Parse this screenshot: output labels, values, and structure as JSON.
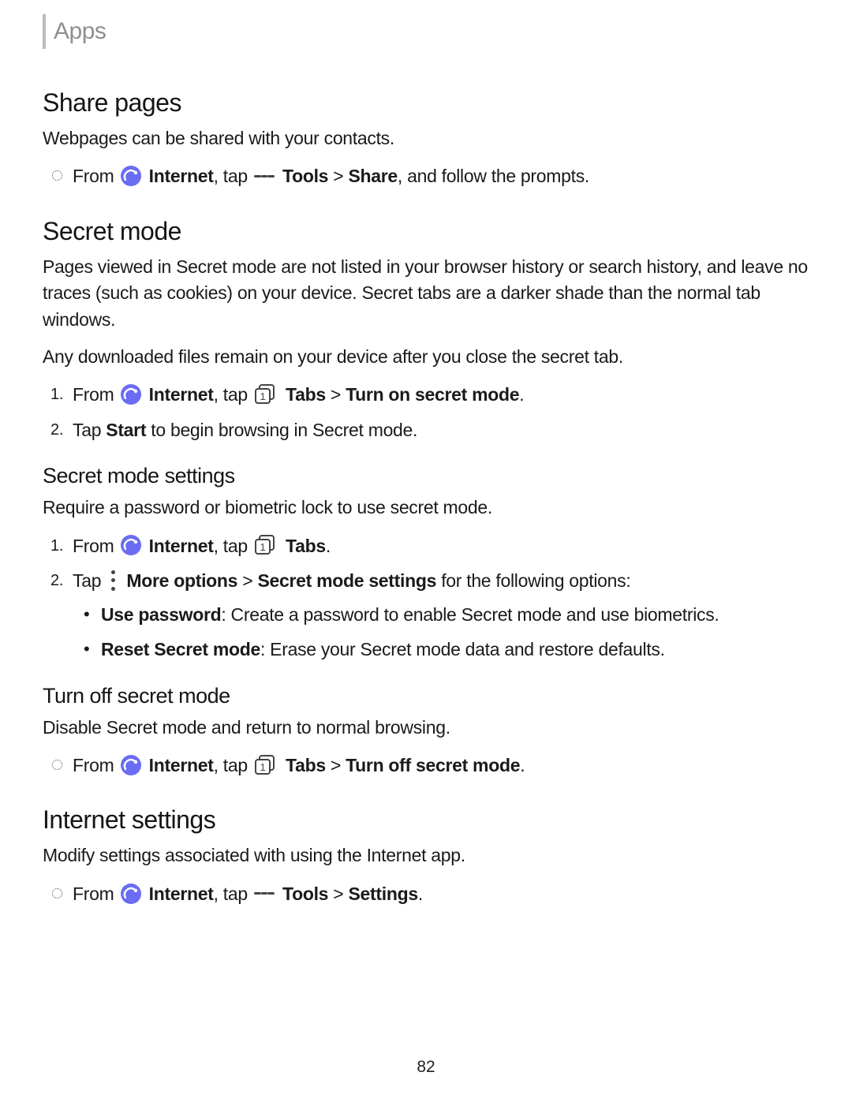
{
  "breadcrumb": "Apps",
  "page_number": "82",
  "sections": {
    "share_pages": {
      "title": "Share pages",
      "intro": "Webpages can be shared with your contacts.",
      "step": {
        "from": "From ",
        "internet": "Internet",
        "tap": ", tap ",
        "tools": "Tools",
        "path": " > ",
        "share": "Share",
        "rest": ", and follow the prompts."
      }
    },
    "secret_mode": {
      "title": "Secret mode",
      "p1": "Pages viewed in Secret mode are not listed in your browser history or search history, and leave no traces (such as cookies) on your device. Secret tabs are a darker shade than the normal tab windows.",
      "p2": "Any downloaded files remain on your device after you close the secret tab.",
      "step1": {
        "from": "From ",
        "internet": "Internet",
        "tap": ", tap ",
        "tabs": "Tabs",
        "path": " > ",
        "action": "Turn on secret mode",
        "end": "."
      },
      "step2": {
        "pre": "Tap ",
        "start": "Start",
        "rest": " to begin browsing in Secret mode."
      }
    },
    "secret_settings": {
      "title": "Secret mode settings",
      "intro": "Require a password or biometric lock to use secret mode.",
      "step1": {
        "from": "From ",
        "internet": "Internet",
        "tap": ", tap ",
        "tabs": "Tabs",
        "end": "."
      },
      "step2": {
        "pre": "Tap ",
        "more": "More options",
        "path": " > ",
        "sms": "Secret mode settings",
        "rest": " for the following options:"
      },
      "sub1": {
        "label": "Use password",
        "desc": ": Create a password to enable Secret mode and use biometrics."
      },
      "sub2": {
        "label": "Reset Secret mode",
        "desc": ": Erase your Secret mode data and restore defaults."
      }
    },
    "turn_off": {
      "title": "Turn off secret mode",
      "intro": "Disable Secret mode and return to normal browsing.",
      "step": {
        "from": "From ",
        "internet": "Internet",
        "tap": ", tap ",
        "tabs": "Tabs",
        "path": " > ",
        "action": "Turn off secret mode",
        "end": "."
      }
    },
    "internet_settings": {
      "title": "Internet settings",
      "intro": "Modify settings associated with using the Internet app.",
      "step": {
        "from": "From ",
        "internet": "Internet",
        "tap": ", tap ",
        "tools": "Tools",
        "path": " > ",
        "settings": "Settings",
        "end": "."
      }
    }
  }
}
